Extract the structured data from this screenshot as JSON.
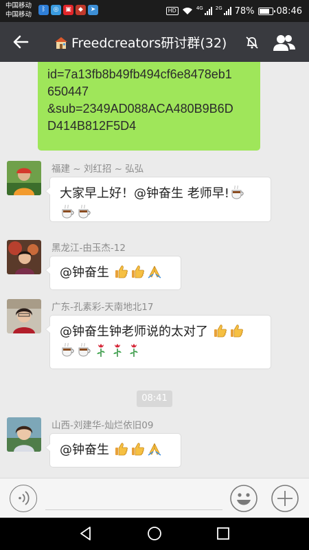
{
  "status_bar": {
    "carrier_1": "中国移动",
    "carrier_2": "中国移动",
    "hd": "HD",
    "net_1": "4G",
    "net_2": "2G",
    "battery": "78%",
    "time": "08:46",
    "app_icons": [
      "bluetooth-icon",
      "browser-icon",
      "news-app-icon",
      "shop-app-icon",
      "send-icon"
    ]
  },
  "header": {
    "group_icon": "house-icon",
    "title": "Freedcreators研讨群(32)"
  },
  "chat": {
    "link_message": {
      "lines": [
        "id=7a13fb8b49fb494cf6e8478eb1",
        "650447",
        "&sub=2349AD088ACA480B9B6D",
        "D414B812F5D4"
      ],
      "bubble_color": "#9fe65a"
    },
    "messages": [
      {
        "sender": "福建 ~ 刘红招 ~ 弘弘",
        "text_line_1": "大家早上好！@钟奋生  老师早!",
        "emojis": [
          "coffee-emoji",
          "coffee-emoji",
          "coffee-emoji"
        ]
      },
      {
        "sender": "黑龙江-由玉杰-12",
        "text": "@钟奋生",
        "emojis": [
          "thumbs-up-emoji",
          "thumbs-up-emoji",
          "joined-hands-emoji"
        ]
      },
      {
        "sender": "广东-孔素彩-天南地北17",
        "text": "@钟奋生钟老师说的太对了",
        "emojis": [
          "thumbs-up-emoji",
          "thumbs-up-emoji",
          "coffee-emoji",
          "coffee-emoji",
          "rose-emoji",
          "rose-emoji",
          "rose-emoji"
        ]
      },
      {
        "sender": "山西-刘建华-灿烂依旧09",
        "text": "@钟奋生",
        "emojis": [
          "thumbs-up-emoji",
          "thumbs-up-emoji",
          "joined-hands-emoji"
        ]
      }
    ],
    "timestamp": "08:41"
  },
  "colors": {
    "status_bar": "#1c1c1c",
    "title_bar": "#393a3f",
    "chat_background": "#ebebeb",
    "sent_bubble": "#9fe65a",
    "received_bubble": "#ffffff"
  }
}
